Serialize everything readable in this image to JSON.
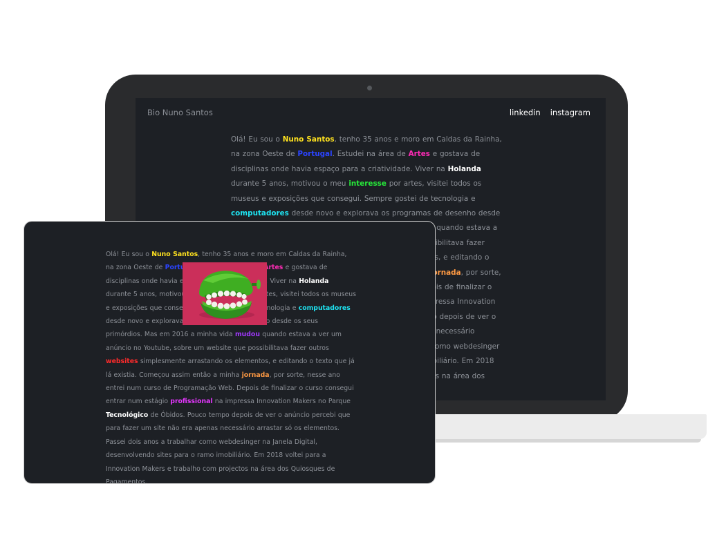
{
  "site": {
    "title": "Bio Nuno Santos",
    "nav": [
      {
        "label": "linkedin"
      },
      {
        "label": "instagram"
      }
    ]
  },
  "bio": {
    "p01": "Olá! Eu sou o ",
    "name": "Nuno Santos",
    "p02": ", tenho 35 anos e moro em Caldas da Rainha, na zona Oeste de ",
    "country": "Portugal",
    "p03": ". Estudei na área de ",
    "field": "Artes",
    "p04": " e gostava de disciplinas onde havia espaço para a criatividade. Viver na ",
    "place": "Holanda",
    "p05": " durante 5 anos, motivou o meu ",
    "interest": "interesse",
    "p06": " por artes, visitei todos os museus e exposições que consegui. Sempre gostei de tecnologia e ",
    "computers": "computadores",
    "p07": " desde novo e explorava os programas de desenho desde os seus primórdios. Mas em 2016 a minha vida ",
    "changed": "mudou",
    "p08": " quando estava a ver um anúncio no Youtube, sobre um website que possibilitava fazer outros ",
    "websites": "websites",
    "p09": " simplesmente arrastando os elementos, e editando o texto que já lá existia. Começou assim então a minha ",
    "journey": "jornada",
    "p10": ", por sorte, nesse ano entrei num curso de Programação Web. Depois de finalizar o curso consegui entrar num estágio ",
    "professional": "profissional",
    "p11": " na impressa Innovation Makers no Parque ",
    "tech": "Tecnológico",
    "p12": " de Óbidos. Pouco tempo depois de ver o anúncio percebi que para fazer um site não era apenas necessário arrastar só os elementos. Passei dois anos a trabalhar como webdesinger na Janela Digital, desenvolvendo sites para o ramo imobiliário. Em 2018 voltei para a Innovation Makers e trabalho com projectos na área dos Quiosques de Pagamentos."
  },
  "image": {
    "icon": "wind-up-chattering-teeth-photo"
  },
  "colors": {
    "background": "#1d2025",
    "text": "#8d9198",
    "yellow": "#ffe21f",
    "blue": "#2b44ff",
    "pink": "#ff2bb6",
    "green": "#27ea3a",
    "cyan": "#1ee4f2",
    "purple": "#a238ff",
    "red": "#ff2b2b",
    "orange": "#ff9a43",
    "magenta": "#e536ff"
  }
}
